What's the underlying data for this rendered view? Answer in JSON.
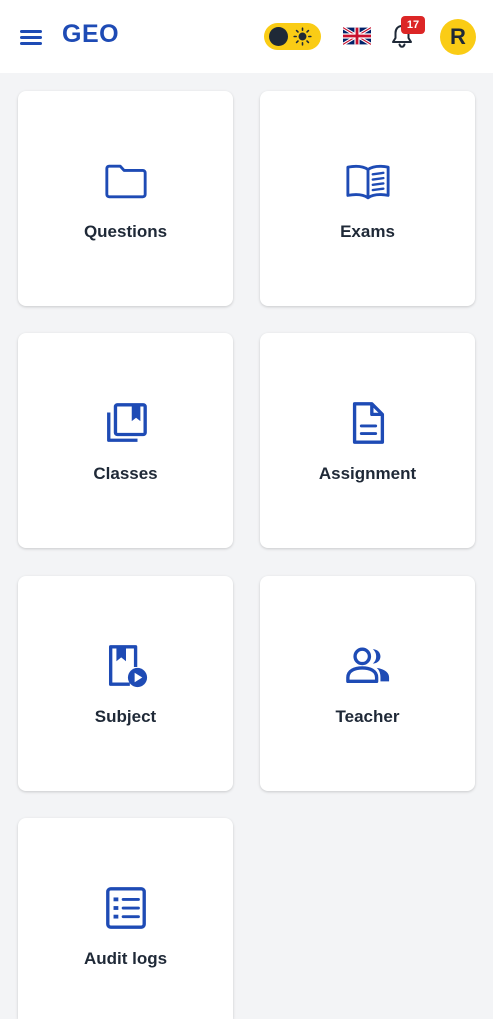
{
  "header": {
    "brand": "GEO",
    "notification_count": "17",
    "avatar_initial": "R",
    "language_icon": "uk-flag-icon",
    "theme_icon": "sun-icon"
  },
  "colors": {
    "primary": "#1e4bb5",
    "accent_yellow": "#facc15",
    "badge_red": "#dc2626",
    "background": "#f3f4f6",
    "card": "#ffffff"
  },
  "cards": [
    {
      "label": "Questions",
      "icon": "folder-icon"
    },
    {
      "label": "Exams",
      "icon": "open-book-icon"
    },
    {
      "label": "Classes",
      "icon": "bookmarks-stack-icon"
    },
    {
      "label": "Assignment",
      "icon": "document-icon"
    },
    {
      "label": "Subject",
      "icon": "book-play-icon"
    },
    {
      "label": "Teacher",
      "icon": "people-icon"
    },
    {
      "label": "Audit logs",
      "icon": "list-icon"
    }
  ]
}
